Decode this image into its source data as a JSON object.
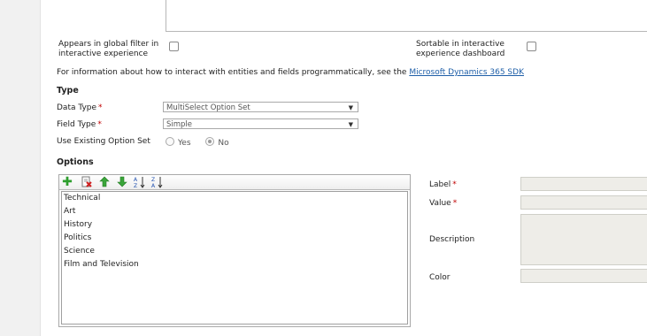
{
  "top": {
    "global_filter_label_1": "Appears in global filter in",
    "global_filter_label_2": "interactive experience",
    "sortable_label_1": "Sortable in interactive",
    "sortable_label_2": "experience dashboard",
    "info_text": "For information about how to interact with entities and fields programmatically, see the",
    "sdk_link": "Microsoft Dynamics 365 SDK"
  },
  "type_section": {
    "title": "Type",
    "data_type_label": "Data Type",
    "data_type_value": "MultiSelect Option Set",
    "field_type_label": "Field Type",
    "field_type_value": "Simple",
    "use_existing_label": "Use Existing Option Set",
    "yes_label": "Yes",
    "no_label": "No",
    "selected": "No",
    "required_mark": "*"
  },
  "options_section": {
    "title": "Options",
    "toolbar_icons": [
      "add-icon",
      "delete-icon",
      "move-up-icon",
      "move-down-icon",
      "sort-ascending-icon",
      "sort-descending-icon"
    ],
    "items": [
      "Technical",
      "Art",
      "History",
      "Politics",
      "Science",
      "Film and Television"
    ]
  },
  "details": {
    "label_label": "Label",
    "value_label": "Value",
    "description_label": "Description",
    "color_label": "Color"
  },
  "colors": {
    "required": "#c00000",
    "link": "#1f5fa8",
    "add_green": "#2e9e2e",
    "arrow_green": "#3aa53a",
    "field_bg": "#eeede8"
  }
}
